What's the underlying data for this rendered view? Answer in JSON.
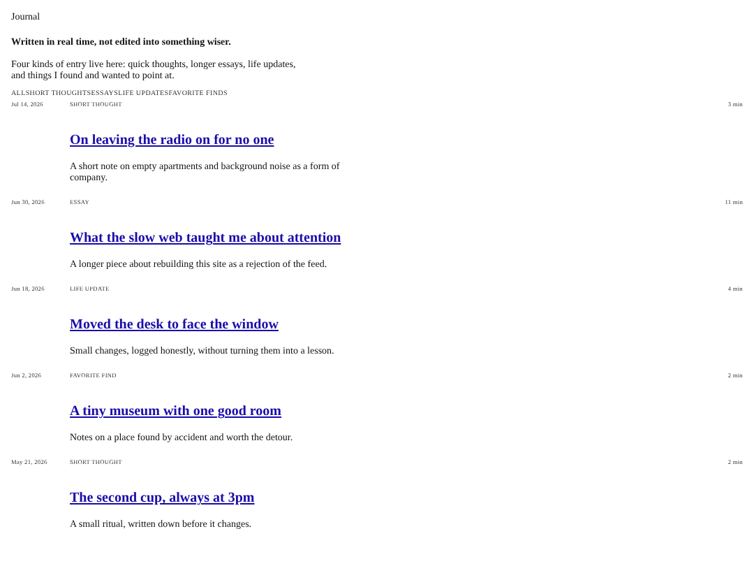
{
  "site_title": "Journal",
  "tagline": "Written in real time, not edited into something wiser.",
  "intro": "Four kinds of entry live here: quick thoughts, longer essays, life updates, and things I found and wanted to point at.",
  "filters": [
    {
      "label": "ALL"
    },
    {
      "label": "SHORT THOUGHTS"
    },
    {
      "label": "ESSAYS"
    },
    {
      "label": "LIFE UPDATES"
    },
    {
      "label": "FAVORITE FINDS"
    }
  ],
  "entries": [
    {
      "date": "Jul 14, 2026",
      "category": "SHORT THOUGHT",
      "read_time": "3 min",
      "title": "On leaving the radio on for no one",
      "excerpt": "A short note on empty apartments and background noise as a form of company."
    },
    {
      "date": "Jun 30, 2026",
      "category": "ESSAY",
      "read_time": "11 min",
      "title": "What the slow web taught me about attention",
      "excerpt": "A longer piece about rebuilding this site as a rejection of the feed."
    },
    {
      "date": "Jun 18, 2026",
      "category": "LIFE UPDATE",
      "read_time": "4 min",
      "title": "Moved the desk to face the window",
      "excerpt": "Small changes, logged honestly, without turning them into a lesson."
    },
    {
      "date": "Jun 2, 2026",
      "category": "FAVORITE FIND",
      "read_time": "2 min",
      "title": "A tiny museum with one good room",
      "excerpt": "Notes on a place found by accident and worth the detour."
    },
    {
      "date": "May 21, 2026",
      "category": "SHORT THOUGHT",
      "read_time": "2 min",
      "title": "The second cup, always at 3pm",
      "excerpt": "A small ritual, written down before it changes."
    }
  ]
}
